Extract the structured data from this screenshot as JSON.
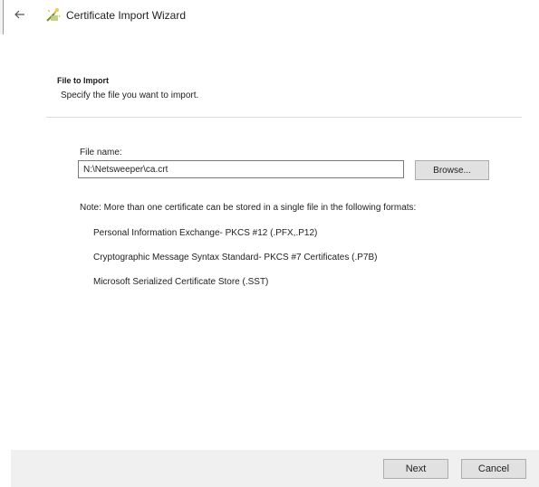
{
  "window": {
    "title": "Certificate Import Wizard",
    "back_icon": "back-arrow-icon",
    "wizard_icon": "certificate-wizard-icon"
  },
  "header": {
    "title": "File to Import",
    "description": "Specify the file you want to import."
  },
  "file": {
    "label": "File name:",
    "value": "N:\\Netsweeper\\ca.crt",
    "browse_label": "Browse..."
  },
  "note": "Note:  More than one certificate can be stored in a single file in the following formats:",
  "formats": [
    "Personal Information Exchange- PKCS #12 (.PFX,.P12)",
    "Cryptographic Message Syntax Standard- PKCS #7 Certificates (.P7B)",
    "Microsoft Serialized Certificate Store (.SST)"
  ],
  "footer": {
    "next_label": "Next",
    "cancel_label": "Cancel"
  },
  "colors": {
    "button_face": "#e1e1e1",
    "button_border": "#adadad",
    "footer_bg": "#f0f0f0",
    "separator": "#dcdcdc"
  }
}
